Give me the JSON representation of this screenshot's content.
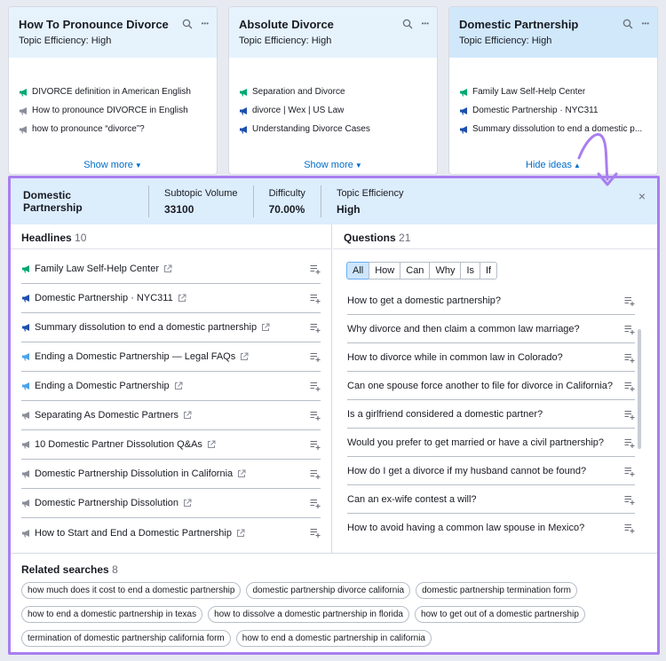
{
  "cards": [
    {
      "title": "How To Pronounce Divorce",
      "efficiency": "Topic Efficiency: High",
      "items": [
        {
          "text": "DIVORCÉ definition in American English",
          "icon": "green"
        },
        {
          "text": "How to pronounce DIVORCE in English",
          "icon": "gray"
        },
        {
          "text": "how to pronounce “divorce”?",
          "icon": "gray"
        }
      ],
      "toggle": "Show more"
    },
    {
      "title": "Absolute Divorce",
      "efficiency": "Topic Efficiency: High",
      "items": [
        {
          "text": "Separation and Divorce",
          "icon": "green"
        },
        {
          "text": "divorce | Wex | US Law",
          "icon": "blue"
        },
        {
          "text": "Understanding Divorce Cases",
          "icon": "blue"
        }
      ],
      "toggle": "Show more"
    },
    {
      "title": "Domestic Partnership",
      "efficiency": "Topic Efficiency: High",
      "items": [
        {
          "text": "Family Law Self-Help Center",
          "icon": "green"
        },
        {
          "text": "Domestic Partnership · NYC311",
          "icon": "blue"
        },
        {
          "text": "Summary dissolution to end a domestic p...",
          "icon": "blue"
        }
      ],
      "toggle": "Hide ideas"
    }
  ],
  "panel": {
    "title": "Domestic Partnership",
    "metrics": [
      {
        "label": "Subtopic Volume",
        "value": "33100"
      },
      {
        "label": "Difficulty",
        "value": "70.00%"
      },
      {
        "label": "Topic Efficiency",
        "value": "High"
      }
    ],
    "close": "×"
  },
  "headlines": {
    "label": "Headlines",
    "count": "10",
    "items": [
      {
        "text": "Family Law Self-Help Center",
        "icon": "green"
      },
      {
        "text": "Domestic Partnership · NYC311",
        "icon": "blue"
      },
      {
        "text": "Summary dissolution to end a domestic partnership",
        "icon": "blue"
      },
      {
        "text": "Ending a Domestic Partnership — Legal FAQs",
        "icon": "lightblue"
      },
      {
        "text": "Ending a Domestic Partnership",
        "icon": "lightblue"
      },
      {
        "text": "Separating As Domestic Partners",
        "icon": "gray"
      },
      {
        "text": "10 Domestic Partner Dissolution Q&As",
        "icon": "gray"
      },
      {
        "text": "Domestic Partnership Dissolution in California",
        "icon": "gray"
      },
      {
        "text": "Domestic Partnership Dissolution",
        "icon": "gray"
      },
      {
        "text": "How to Start and End a Domestic Partnership",
        "icon": "gray"
      }
    ]
  },
  "questions": {
    "label": "Questions",
    "count": "21",
    "filters": [
      "All",
      "How",
      "Can",
      "Why",
      "Is",
      "If"
    ],
    "items": [
      "How to get a domestic partnership?",
      "Why divorce and then claim a common law marriage?",
      "How to divorce while in common law in Colorado?",
      "Can one spouse force another to file for divorce in California?",
      "Is a girlfriend considered a domestic partner?",
      "Would you prefer to get married or have a civil partnership?",
      "How do I get a divorce if my husband cannot be found?",
      "Can an ex-wife contest a will?",
      "How to avoid having a common law spouse in Mexico?"
    ]
  },
  "related": {
    "label": "Related searches",
    "count": "8",
    "chips": [
      "how much does it cost to end a domestic partnership",
      "domestic partnership divorce california",
      "domestic partnership termination form",
      "how to end a domestic partnership in texas",
      "how to dissolve a domestic partnership in florida",
      "how to get out of a domestic partnership",
      "termination of domestic partnership california form",
      "how to end a domestic partnership in california"
    ]
  },
  "colors": {
    "green": "#00a870",
    "blue": "#1d4fad",
    "lightblue": "#4ba3e8",
    "gray": "#8b8e99",
    "accent": "#006dca",
    "highlight": "#a97ef0"
  }
}
